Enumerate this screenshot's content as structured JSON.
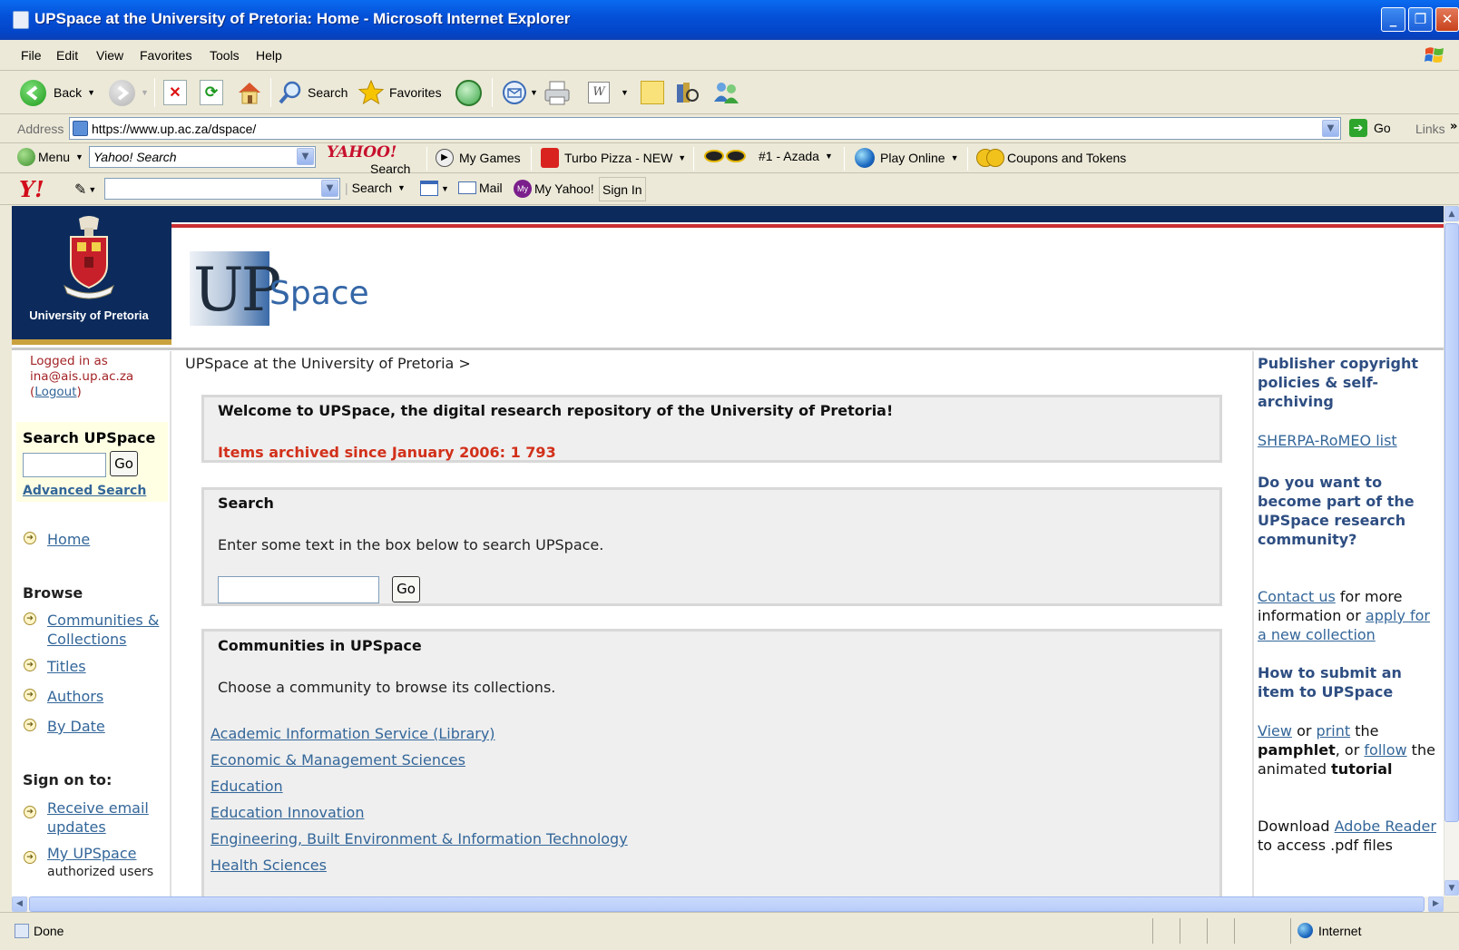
{
  "window": {
    "title": "UPSpace at the University of Pretoria: Home - Microsoft Internet Explorer"
  },
  "menu": {
    "items": [
      "File",
      "Edit",
      "View",
      "Favorites",
      "Tools",
      "Help"
    ]
  },
  "toolbar": {
    "back": "Back",
    "search": "Search",
    "favorites": "Favorites"
  },
  "address": {
    "label": "Address",
    "url": "https://www.up.ac.za/dspace/",
    "go": "Go",
    "links": "Links"
  },
  "yahoo_bar1": {
    "menu": "Menu",
    "search_field": "Yahoo! Search",
    "yahoo_logo": "YAHOO!",
    "yahoo_search_sub": "Search",
    "my_games": "My Games",
    "turbo_pizza": "Turbo Pizza - NEW",
    "azada": "#1 - Azada",
    "play_online": "Play Online",
    "coupons": "Coupons and Tokens"
  },
  "yahoo_bar2": {
    "logo": "Y!",
    "search": "Search",
    "mail": "Mail",
    "my_yahoo": "My Yahoo!",
    "sign_in": "Sign In"
  },
  "header": {
    "university": "University of Pretoria",
    "logo_up": "UP",
    "logo_space": "Space"
  },
  "leftnav": {
    "logged_in_line1": "Logged in as",
    "logged_in_email": "ina@ais.up.ac.za",
    "logout_open": "(",
    "logout": "Logout",
    "logout_close": ")",
    "search_title": "Search UPSpace",
    "search_go": "Go",
    "advanced_search": "Advanced Search",
    "home": "Home",
    "browse_heading": "Browse",
    "browse": [
      "Communities & Collections",
      "Titles",
      "Authors",
      "By Date"
    ],
    "signon_heading": "Sign on to:",
    "receive_email": "Receive email updates",
    "my_upspace": "My UPSpace",
    "authorized_users": "authorized users"
  },
  "main": {
    "breadcrumb": "UPSpace at the University of Pretoria >",
    "welcome_text": "Welcome to UPSpace, the digital research repository of the University of Pretoria!",
    "items_archived": "Items archived since January 2006: 1 793",
    "search_heading": "Search",
    "search_instructions": "Enter some text in the box below to search UPSpace.",
    "search_go": "Go",
    "communities_heading": "Communities in UPSpace",
    "communities_instructions": "Choose a community to browse its collections.",
    "communities": [
      "Academic Information Service (Library)",
      "Economic & Management Sciences",
      "Education",
      "Education Innovation",
      "Engineering, Built Environment & Information Technology",
      "Health Sciences"
    ]
  },
  "rightcol": {
    "publisher_heading": "Publisher copyright policies & self-archiving",
    "sherpa": "SHERPA-RoMEO list",
    "join_heading": "Do you want to become part of the UPSpace research community?",
    "contact_us": "Contact us",
    "for_more_info": "for more information or",
    "apply": "apply for a new collection",
    "submit_heading": "How to submit an item to UPSpace",
    "view": "View",
    "or": "or",
    "print": "print",
    "the": "the",
    "pamphlet": "pamphlet",
    "or_comma": ", or",
    "follow": "follow",
    "the_animated": "the animated",
    "tutorial": "tutorial",
    "download": "Download",
    "adobe_reader": "Adobe Reader",
    "to_access": "to access .pdf files"
  },
  "status": {
    "text": "Done",
    "zone": "Internet"
  }
}
